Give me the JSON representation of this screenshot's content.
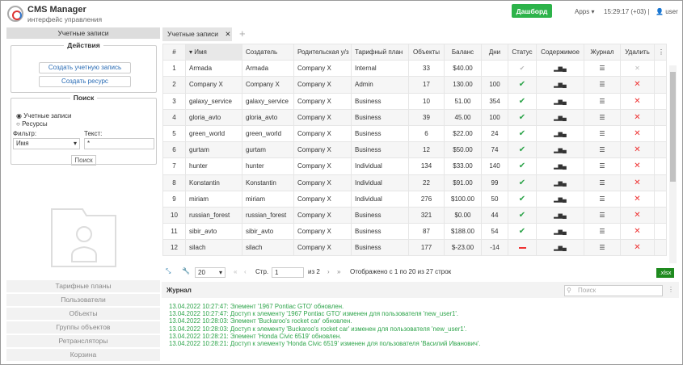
{
  "header": {
    "title": "CMS Manager",
    "subtitle": "интерфейс управления",
    "dashboard": "Дашборд",
    "apps": "Apps",
    "clock": "15:29:17 (+03)",
    "user": "user"
  },
  "sidebar": {
    "title": "Учетные записи",
    "actions_legend": "Действия",
    "create_account": "Создать учетную запись",
    "create_resource": "Создать ресурс",
    "search_legend": "Поиск",
    "radio_accounts": "Учетные записи",
    "radio_resources": "Ресурсы",
    "filter_label": "Фильтр:",
    "filter_value": "Имя",
    "text_label": "Текст:",
    "text_value": "*",
    "search_btn": "Поиск",
    "menu": [
      "Тарифные планы",
      "Пользователи",
      "Объекты",
      "Группы объектов",
      "Ретрансляторы",
      "Корзина"
    ]
  },
  "tab": {
    "label": "Учетные записи"
  },
  "table": {
    "columns": [
      "#",
      "Имя",
      "Создатель",
      "Родительская у/з",
      "Тарифный план",
      "Объекты",
      "Баланс",
      "Дни",
      "Статус",
      "Содержимое",
      "Журнал",
      "Удалить"
    ],
    "rows": [
      [
        "1",
        "Armada",
        "Armada",
        "Company X",
        "Internal",
        "33",
        "$40.00",
        "",
        "inactive"
      ],
      [
        "2",
        "Company X",
        "Company X",
        "Company X",
        "Admin",
        "17",
        "130.00",
        "100",
        "ok"
      ],
      [
        "3",
        "galaxy_service",
        "galaxy_service",
        "Company X",
        "Business",
        "10",
        "51.00",
        "354",
        "ok"
      ],
      [
        "4",
        "gloria_avto",
        "gloria_avto",
        "Company X",
        "Business",
        "39",
        "45.00",
        "100",
        "ok"
      ],
      [
        "5",
        "green_world",
        "green_world",
        "Company X",
        "Business",
        "6",
        "$22.00",
        "24",
        "ok"
      ],
      [
        "6",
        "gurtam",
        "gurtam",
        "Company X",
        "Business",
        "12",
        "$50.00",
        "74",
        "ok"
      ],
      [
        "7",
        "hunter",
        "hunter",
        "Company X",
        "Individual",
        "134",
        "$33.00",
        "140",
        "ok"
      ],
      [
        "8",
        "Konstantin",
        "Konstantin",
        "Company X",
        "Individual",
        "22",
        "$91.00",
        "99",
        "ok"
      ],
      [
        "9",
        "miriam",
        "miriam",
        "Company X",
        "Individual",
        "276",
        "$100.00",
        "50",
        "ok"
      ],
      [
        "10",
        "russian_forest",
        "russian_forest",
        "Company X",
        "Business",
        "321",
        "$0.00",
        "44",
        "ok"
      ],
      [
        "11",
        "sibir_avto",
        "sibir_avto",
        "Company X",
        "Business",
        "87",
        "$188.00",
        "54",
        "ok"
      ],
      [
        "12",
        "silach",
        "silach",
        "Company X",
        "Business",
        "177",
        "$-23.00",
        "-14",
        "blocked"
      ]
    ]
  },
  "pager": {
    "page_size": "20",
    "page_label": "Стр.",
    "page": "1",
    "of": "из 2",
    "info": "Отображено с 1 по 20 из 27 строк",
    "export": ".xlsx"
  },
  "log": {
    "title": "Журнал",
    "search_placeholder": "Поиск",
    "lines": [
      "13.04.2022 10:27:47: Элемент '1967 Pontiac GTO' обновлен.",
      "13.04.2022 10:27:47: Доступ к элементу '1967 Pontiac GTO' изменен для пользователя 'new_user1'.",
      "13.04.2022 10:28:03: Элемент 'Buckaroo's rocket car' обновлен.",
      "13.04.2022 10:28:03: Доступ к элементу 'Buckaroo's rocket car' изменен для пользователя 'new_user1'.",
      "13.04.2022 10:28:21: Элемент 'Honda Civic 6519' обновлен.",
      "13.04.2022 10:28:21: Доступ к элементу 'Honda Civic 6519' изменен для пользователя 'Василий Иванович'."
    ]
  }
}
